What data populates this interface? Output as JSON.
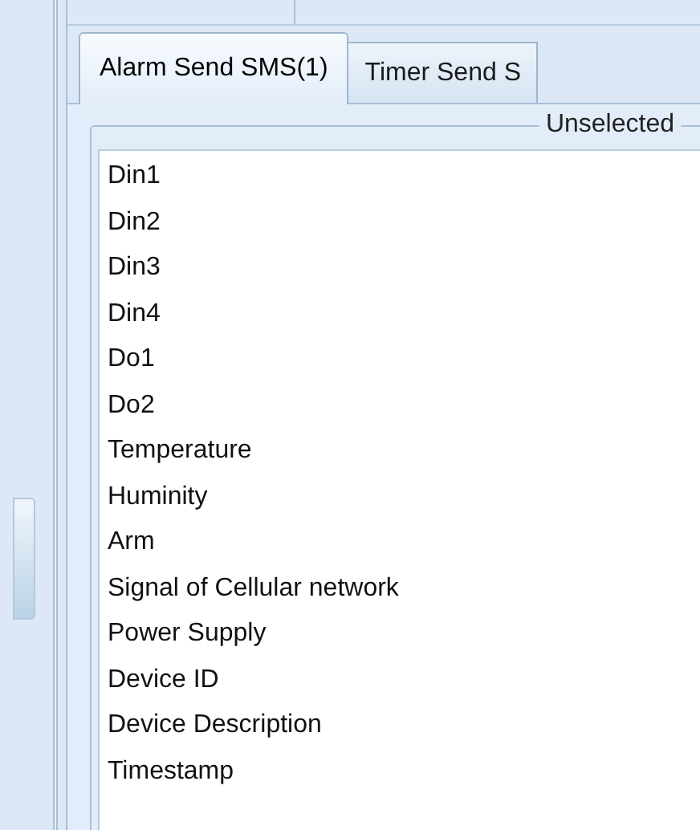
{
  "tabs": [
    {
      "label": "Alarm Send SMS(1)",
      "selected": true
    },
    {
      "label": "Timer Send S",
      "selected": false
    }
  ],
  "group": {
    "legend": "Unselected"
  },
  "list": {
    "items": [
      "Din1",
      "Din2",
      "Din3",
      "Din4",
      "Do1",
      "Do2",
      "Temperature",
      "Huminity",
      "Arm",
      "Signal of Cellular network",
      "Power Supply",
      "Device ID",
      "Device Description",
      "Timestamp"
    ]
  }
}
